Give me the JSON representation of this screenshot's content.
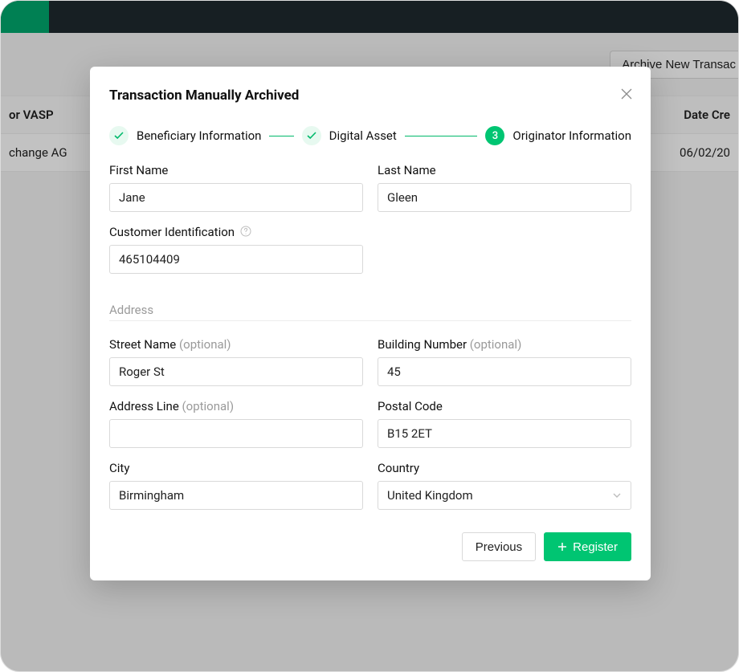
{
  "topbar": {
    "archive_button_label": "Archive New Transac"
  },
  "table": {
    "col_vasp": "or VASP",
    "col_date": "Date Cre",
    "row_vasp": "change AG",
    "row_date": "06/02/20"
  },
  "modal": {
    "title": "Transaction Manually Archived",
    "steps": {
      "s1_label": "Beneficiary Information",
      "s2_label": "Digital Asset",
      "s3_number": "3",
      "s3_label": "Originator Information"
    },
    "fields": {
      "first_name_label": "First Name",
      "first_name_value": "Jane",
      "last_name_label": "Last Name",
      "last_name_value": "Gleen",
      "cust_id_label": "Customer Identification",
      "cust_id_value": "465104409",
      "address_section": "Address",
      "street_label": "Street Name",
      "street_value": "Roger St",
      "building_label": "Building Number",
      "building_value": "45",
      "addr_line_label": "Address Line",
      "addr_line_value": "",
      "postal_label": "Postal Code",
      "postal_value": "B15 2ET",
      "city_label": "City",
      "city_value": "Birmingham",
      "country_label": "Country",
      "country_value": "United Kingdom",
      "optional_text": "(optional)"
    },
    "buttons": {
      "previous": "Previous",
      "register": "Register"
    }
  }
}
